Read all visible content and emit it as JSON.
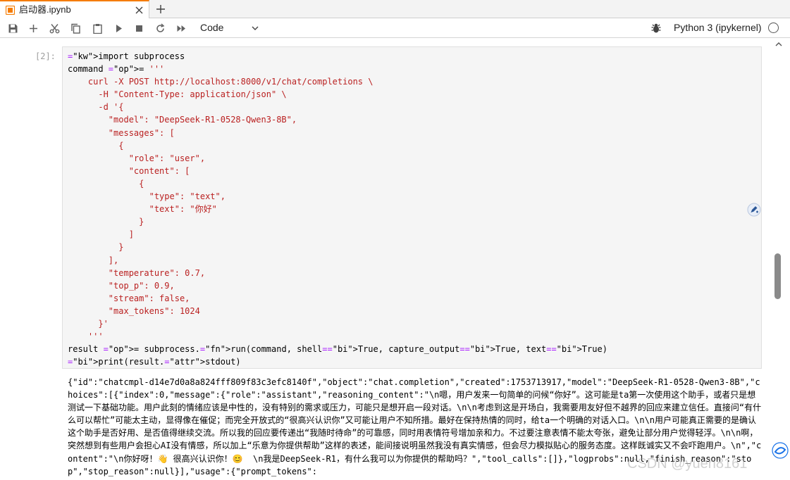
{
  "tab": {
    "title": "启动器.ipynb"
  },
  "toolbar": {
    "cell_type": "Code",
    "kernel_name": "Python 3 (ipykernel)"
  },
  "cell": {
    "prompt": "[2]:",
    "code_lines": [
      "import subprocess",
      "command = '''",
      "    curl -X POST http://localhost:8000/v1/chat/completions \\",
      "      -H \"Content-Type: application/json\" \\",
      "      -d '{",
      "        \"model\": \"DeepSeek-R1-0528-Qwen3-8B\",",
      "        \"messages\": [",
      "          {",
      "            \"role\": \"user\",",
      "            \"content\": [",
      "              {",
      "                \"type\": \"text\",",
      "                \"text\": \"你好\"",
      "              }",
      "            ]",
      "          }",
      "        ],",
      "        \"temperature\": 0.7,",
      "        \"top_p\": 0.9,",
      "        \"stream\": false,",
      "        \"max_tokens\": 1024",
      "      }'",
      "    '''",
      "result = subprocess.run(command, shell=True, capture_output=True, text=True)",
      "print(result.stdout)"
    ],
    "output": "{\"id\":\"chatcmpl-d14e7d0a8a824fff809f83c3efc8140f\",\"object\":\"chat.completion\",\"created\":1753713917,\"model\":\"DeepSeek-R1-0528-Qwen3-8B\",\"choices\":[{\"index\":0,\"message\":{\"role\":\"assistant\",\"reasoning_content\":\"\\n嗯，用户发来一句简单的问候“你好”。这可能是ta第一次使用这个助手，或者只是想测试一下基础功能。用户此刻的情绪应该是中性的，没有特别的需求或压力，可能只是想开启一段对话。\\n\\n考虑到这是开场白，我需要用友好但不越界的回应来建立信任。直接问“有什么可以帮忙”可能太主动，显得像在催促；而完全开放式的“很高兴认识你”又可能让用户不知所措。最好在保持热情的同时，给ta一个明确的对话入口。\\n\\n用户可能真正需要的是确认这个助手是否好用、是否值得继续交流。所以我的回应要传递出“我随时待命”的可靠感，同时用表情符号增加亲和力。不过要注意表情不能太夸张，避免让部分用户觉得轻浮。\\n\\n啊，突然想到有些用户会担心AI没有情感，所以加上“乐意为你提供帮助”这样的表述，能间接说明虽然我没有真实情感，但会尽力模拟贴心的服务态度。这样既诚实又不会吓跑用户。\\n\",\"content\":\"\\n你好呀！👋 很高兴认识你！😊  \\n我是DeepSeek-R1，有什么我可以为你提供的帮助吗？\",\"tool_calls\":[]},\"logprobs\":null,\"finish_reason\":\"stop\",\"stop_reason\":null}],\"usage\":{\"prompt_tokens\":"
  },
  "watermark": "CSDN @yueh8161",
  "colors": {
    "accent_tab": "#f57c00",
    "keyword": "#008000",
    "string": "#ba2121",
    "operator": "#aa22ff",
    "function": "#0000ff"
  }
}
